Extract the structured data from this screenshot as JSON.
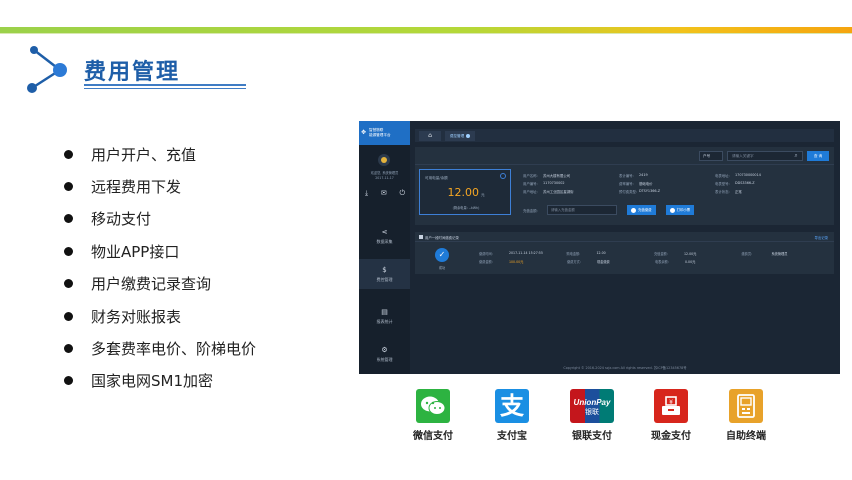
{
  "slide": {
    "title": "费用管理",
    "bullets": [
      "用户开户、充值",
      "远程费用下发",
      "移动支付",
      "物业APP接口",
      "用户缴费记录查询",
      "财务对账报表",
      "多套费率电价、阶梯电价",
      "国家电网SM1加密"
    ]
  },
  "app": {
    "brand": "智慧物联\n能源管理平台",
    "user_info": "欢迎您, 系统管理员\n2017-11-17",
    "nav": [
      {
        "label": "数据采集",
        "icon": "share-icon"
      },
      {
        "label": "费控管理",
        "icon": "dollar-icon"
      },
      {
        "label": "报表统计",
        "icon": "report-icon"
      },
      {
        "label": "系统管理",
        "icon": "gear-icon"
      }
    ],
    "tabs": {
      "active": "费控管理"
    },
    "search": {
      "type": "户号",
      "placeholder": "请输入关键字",
      "button": "查 询"
    },
    "balance": {
      "label": "可用电量/余额",
      "amount": "12.00",
      "unit": "元",
      "note": "(剩余电量: --kWh)"
    },
    "info": [
      [
        {
          "k": "用户名称:",
          "v": "苏州大楼有限公司"
        },
        {
          "k": "表计编号:",
          "v": "2419"
        },
        {
          "k": "电表地址:",
          "v": "170730000014"
        }
      ],
      [
        {
          "k": "用户编号:",
          "v": "1170730002"
        },
        {
          "k": "费率编号:",
          "v": "基础电价"
        },
        {
          "k": "电表型号:",
          "v": "DDS3366-Z"
        }
      ],
      [
        {
          "k": "用户地址:",
          "v": "苏州工业园区星湖街"
        },
        {
          "k": "预付费类型:",
          "v": "DTSY1366-Z"
        },
        {
          "k": "表计状态:",
          "v": "正常"
        }
      ]
    ],
    "recharge": {
      "label": "充值金额:",
      "placeholder": "请输入充值金额",
      "pay_button": "充值缴费",
      "print_button": "打印小票"
    },
    "records": {
      "title": "用户一段时间缴费记录",
      "export": "导出记录",
      "status": "成功",
      "rows": [
        [
          {
            "k": "缴费时间:",
            "v": "2017-11-14 15:27:55"
          },
          {
            "k": "购电金额:",
            "v": "12.00"
          },
          {
            "k": "充值金额:",
            "v": "12.00元"
          },
          {
            "k": "缴费员:",
            "v": "系统管理员"
          }
        ],
        [
          {
            "k": "缴费金额:",
            "v": "100.00元",
            "orange": true
          },
          {
            "k": "缴费方式:",
            "v": "现金缴费"
          },
          {
            "k": "电表余额:",
            "v": "0.00元"
          }
        ]
      ]
    },
    "footer": "Copyright © 2016-2024 szjz.com All rights reserved. 苏ICP备12345678号"
  },
  "payments": [
    {
      "label": "微信支付",
      "color": "#2db341"
    },
    {
      "label": "支付宝",
      "color": "#1a8fe3"
    },
    {
      "label": "银联支付",
      "color": "#c4161c"
    },
    {
      "label": "现金支付",
      "color": "#d7261c"
    },
    {
      "label": "自助终端",
      "color": "#e8a22a"
    }
  ],
  "colors": {
    "accent": "#1e5ea8",
    "band_start": "#9bd14a",
    "band_end": "#f5a40f"
  }
}
